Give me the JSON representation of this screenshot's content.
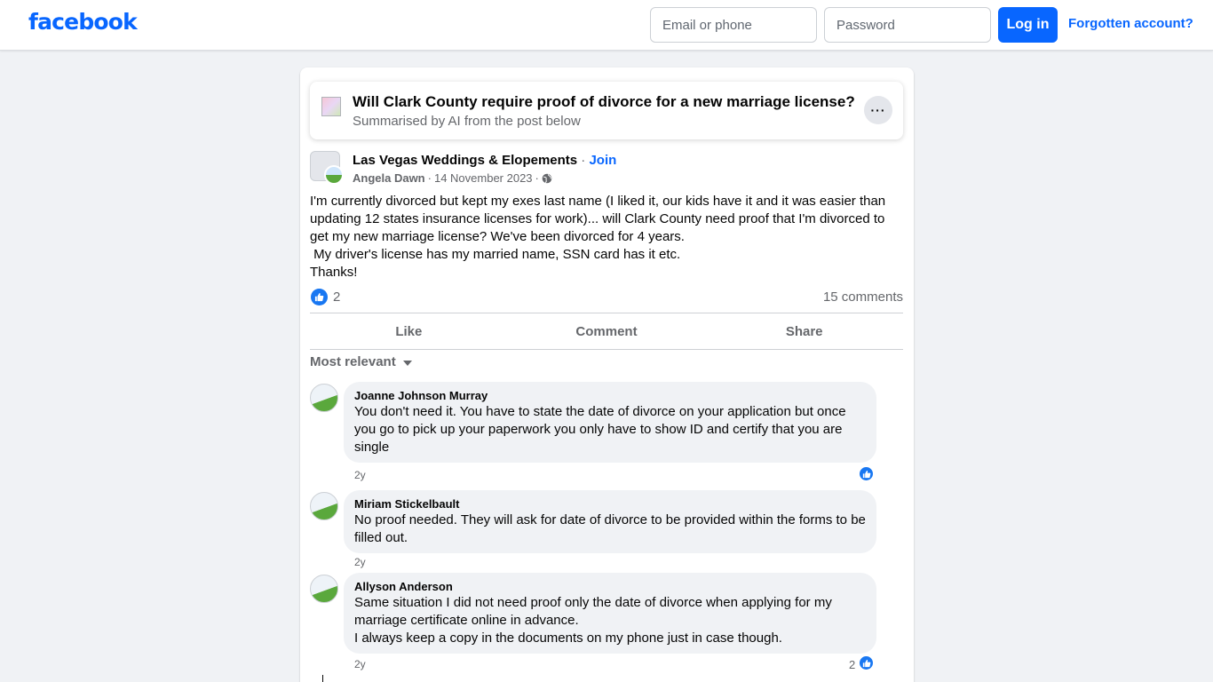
{
  "header": {
    "logo": "facebook",
    "email_placeholder": "Email or phone",
    "password_placeholder": "Password",
    "login_label": "Log in",
    "forgot_label": "Forgotten account?"
  },
  "ai_summary": {
    "title": "Will Clark County require proof of divorce for a new marriage license?",
    "subtitle": "Summarised by AI from the post below",
    "more_label": "···"
  },
  "post": {
    "group_name": "Las Vegas Weddings & Elopements",
    "separator": " · ",
    "join_label": "Join",
    "author": "Angela Dawn",
    "date": "14 November 2023",
    "meta_separator": "·",
    "body": "I'm currently divorced but kept my exes last name (I liked it, our kids have it and it was easier than updating 12 states insurance licenses for work)... will Clark County need proof that I'm divorced to get my new marriage license? We've been divorced for 4 years.\n My driver's license has my married name, SSN card has it etc.\nThanks!",
    "reaction_count": "2",
    "comments_count": "15 comments"
  },
  "actions": {
    "like": "Like",
    "comment": "Comment",
    "share": "Share"
  },
  "sort_label": "Most relevant",
  "comments": [
    {
      "name": "Joanne Johnson Murray",
      "text": "You don't need it. You have to state the date of divorce on your application but once you go to pick up your paperwork you only have to show ID and certify that you are single",
      "time": "2y",
      "likes": ""
    },
    {
      "name": "Miriam Stickelbault",
      "text": "No proof needed. They will ask for date of divorce to be provided within the forms to be filled out.",
      "time": "2y",
      "likes": ""
    },
    {
      "name": "Allyson Anderson",
      "text": "Same situation I did not need proof only the date of divorce when applying for my marriage certificate online in advance.\nI always keep a copy in the documents on my phone just in case though.",
      "time": "2y",
      "likes": "2"
    }
  ],
  "colors": {
    "brand": "#0866ff",
    "like_blue": "#1877f2",
    "secondary_text": "#65676b",
    "page_bg": "#f0f2f5"
  }
}
